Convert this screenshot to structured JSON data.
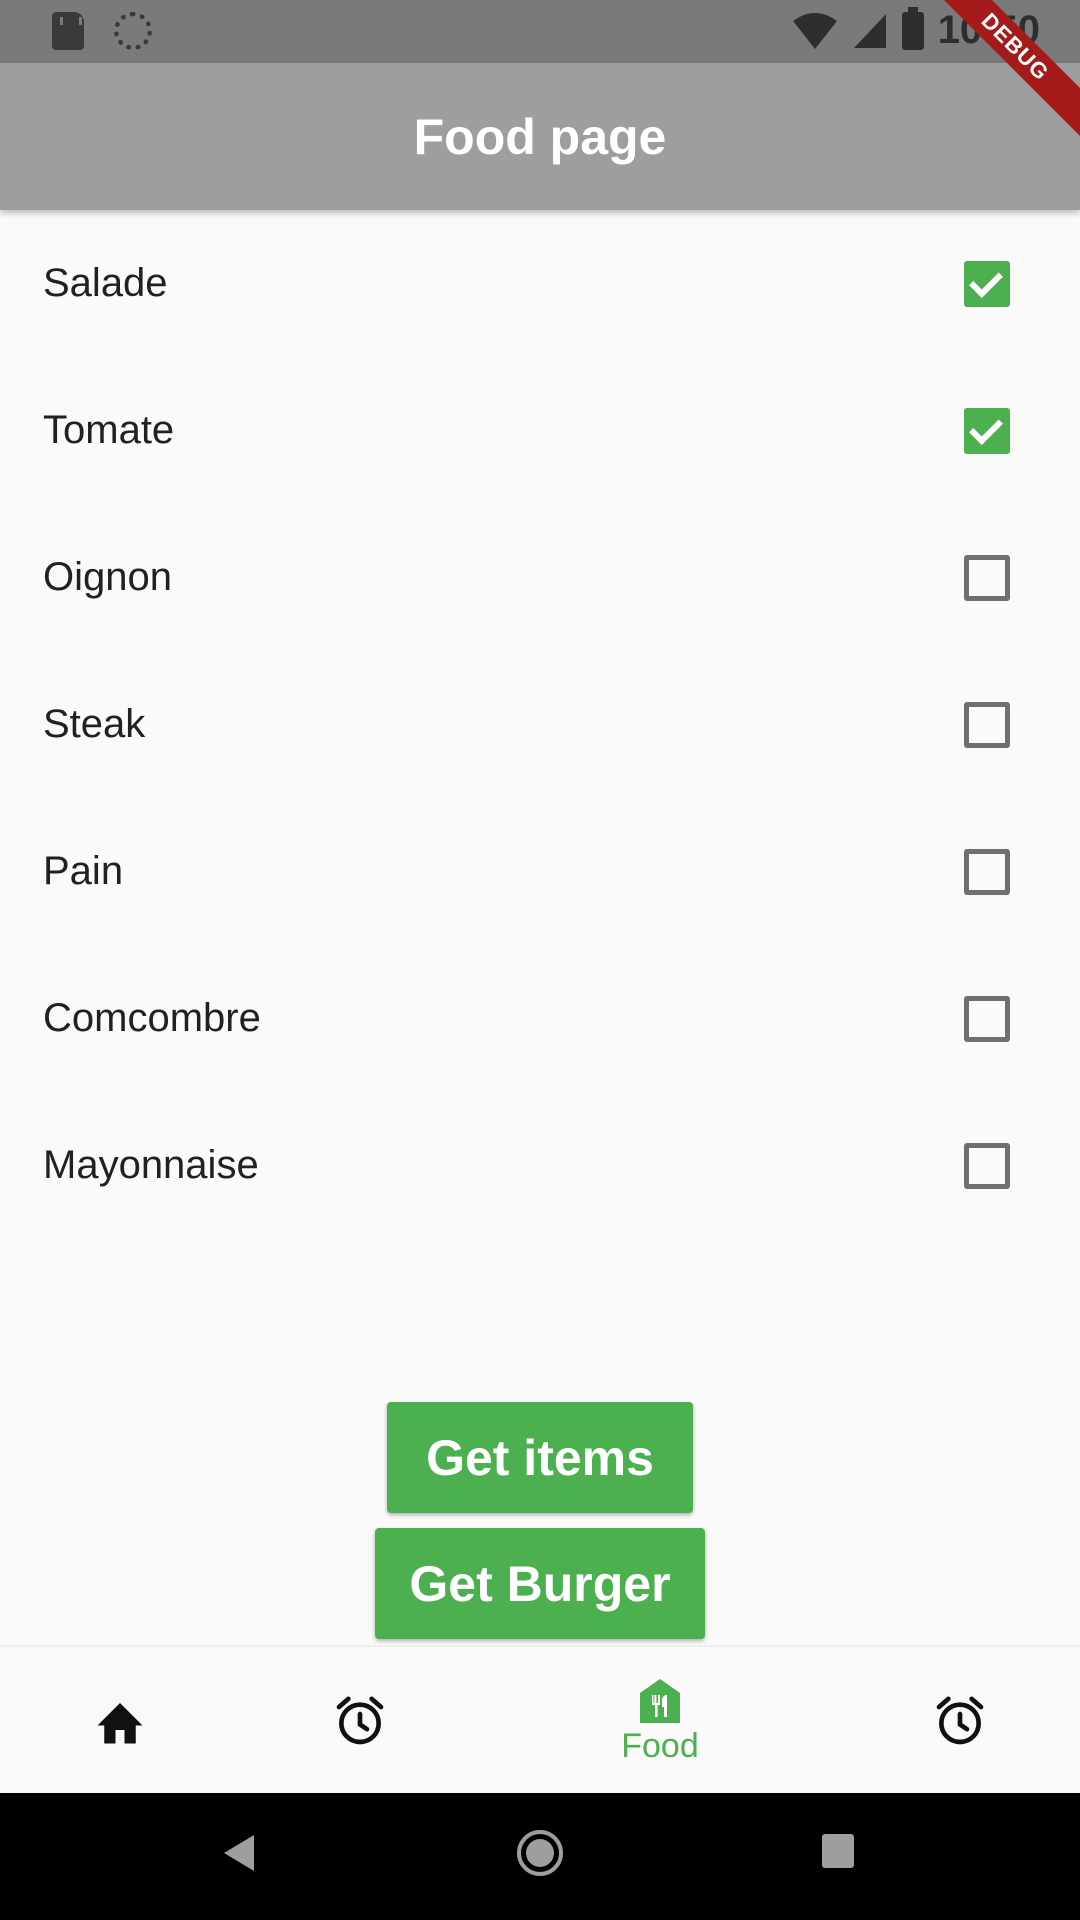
{
  "status_bar": {
    "time": "10:50"
  },
  "debug_banner": "DEBUG",
  "app_bar": {
    "title": "Food page"
  },
  "items": [
    {
      "label": "Salade",
      "checked": true
    },
    {
      "label": "Tomate",
      "checked": true
    },
    {
      "label": "Oignon",
      "checked": false
    },
    {
      "label": "Steak",
      "checked": false
    },
    {
      "label": "Pain",
      "checked": false
    },
    {
      "label": "Comcombre",
      "checked": false
    },
    {
      "label": "Mayonnaise",
      "checked": false
    }
  ],
  "buttons": {
    "get_items": "Get items",
    "get_burger": "Get Burger"
  },
  "bottom_nav": {
    "items": [
      {
        "icon": "home-icon"
      },
      {
        "icon": "alarm-icon"
      },
      {
        "icon": "restaurant-icon",
        "label": "Food",
        "active": true
      },
      {
        "icon": "alarm-icon"
      }
    ]
  },
  "colors": {
    "accent": "#4caf50",
    "app_bar": "#9e9e9e",
    "status_bar": "#7a7a7a",
    "ribbon": "#a31b1b"
  }
}
